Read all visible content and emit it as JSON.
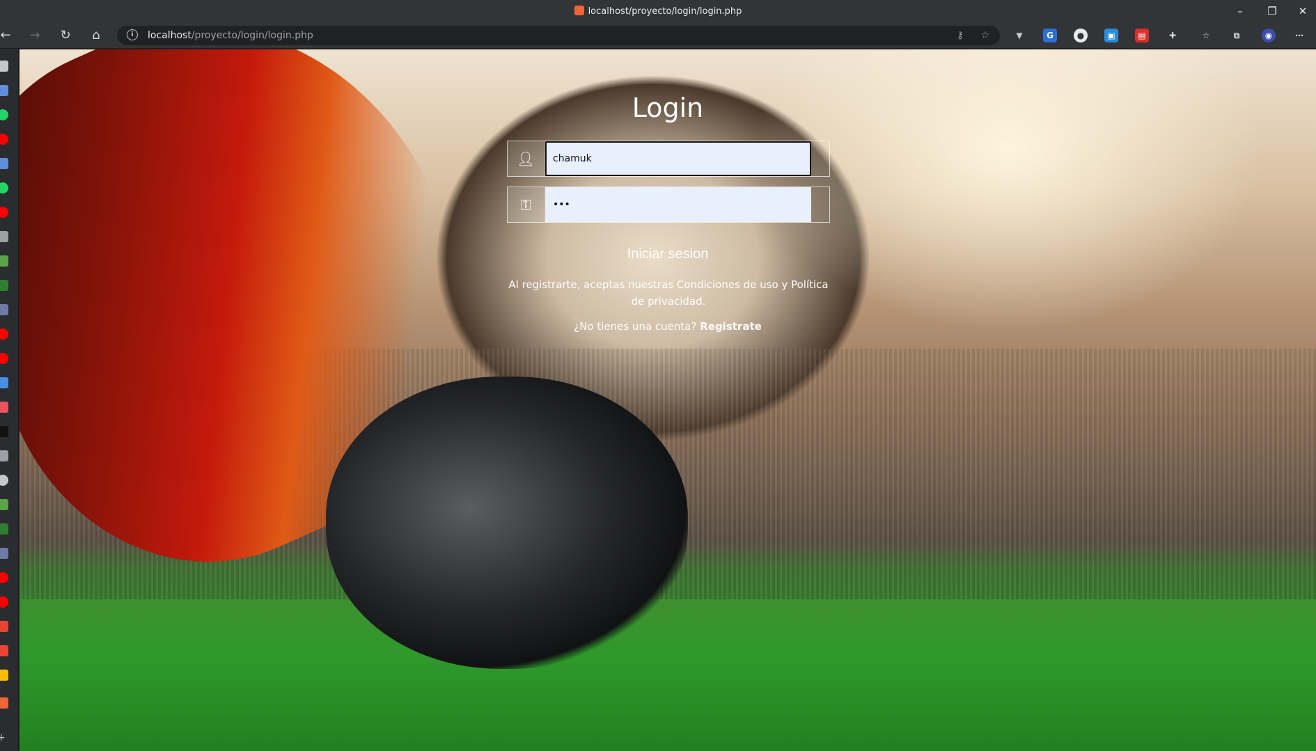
{
  "window": {
    "tab_title": "localhost/proyecto/login/login.php"
  },
  "address_bar": {
    "url_host": "localhost",
    "url_path": "/proyecto/login/login.php"
  },
  "login": {
    "title": "Login",
    "username_value": "chamuk",
    "password_value": "•••",
    "submit_label": "Iniciar sesion",
    "terms_text": "Al registrarte, aceptas nuestras Condiciones de uso y Política de privacidad.",
    "register_prompt": "¿No tienes una cuenta?",
    "register_link": "Registrate"
  }
}
